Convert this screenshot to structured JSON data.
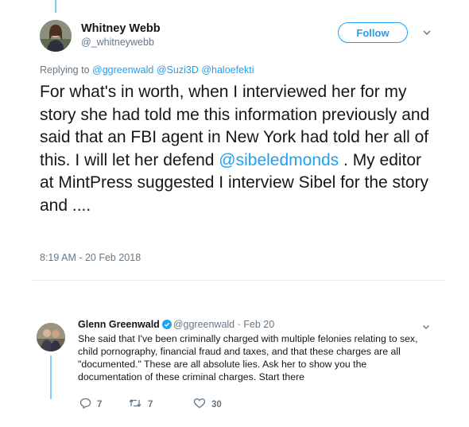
{
  "main_tweet": {
    "author_name": "Whitney Webb",
    "author_handle": "@_whitneywebb",
    "follow_label": "Follow",
    "replying_to_prefix": "Replying to",
    "replying_to": [
      "@ggreenwald",
      "@Suzi3D",
      "@haloefekti"
    ],
    "text_before_mention": "For what's in worth, when I interviewed her for my story she had told me this information previously and said that an FBI agent in New York had told her all of this. I will let her defend ",
    "text_mention": "@sibeledmonds",
    "text_after_mention": " . My editor at MintPress suggested I interview Sibel for the story and ....",
    "timestamp": "8:19 AM - 20 Feb 2018"
  },
  "reply_tweet": {
    "author_name": "Glenn Greenwald",
    "author_handle": "@ggreenwald",
    "date": "· Feb 20",
    "text": "She said that I've been criminally charged with multiple felonies relating to sex, child pornography, financial fraud and taxes, and that these charges are all \"documented.\" These are all absolute lies. Ask her to show you the documentation of these criminal charges. Start there",
    "reply_count": "7",
    "retweet_count": "7",
    "like_count": "30"
  },
  "colors": {
    "accent": "#1da1f2",
    "text": "#14171a",
    "secondary": "#657786"
  }
}
